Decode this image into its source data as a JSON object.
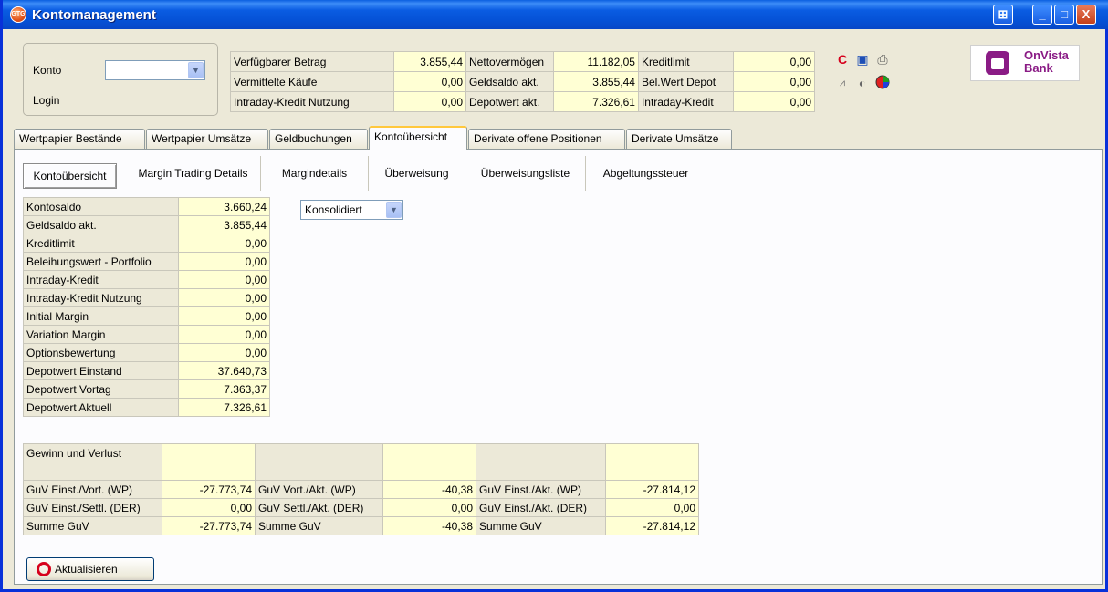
{
  "window": {
    "title": "Kontomanagement",
    "app_icon": "GTG",
    "min": "_",
    "max": "□",
    "close": "X",
    "extra": "⊞"
  },
  "login": {
    "konto_label": "Konto",
    "login_label": "Login",
    "konto_value": ""
  },
  "summary": [
    [
      "Verfügbarer Betrag",
      "3.855,44",
      "Nettovermögen",
      "11.182,05",
      "Kreditlimit",
      "0,00"
    ],
    [
      "Vermittelte Käufe",
      "0,00",
      "Geldsaldo akt.",
      "3.855,44",
      "Bel.Wert Depot",
      "0,00"
    ],
    [
      "Intraday-Kredit Nutzung",
      "0,00",
      "Depotwert akt.",
      "7.326,61",
      "Intraday-Kredit",
      "0,00"
    ]
  ],
  "logo": {
    "line1": "OnVista",
    "line2": "Bank"
  },
  "tabs": [
    "Wertpapier Bestände",
    "Wertpapier Umsätze",
    "Geldbuchungen",
    "Kontoübersicht",
    "Derivate offene Positionen",
    "Derivate Umsätze"
  ],
  "subtabs": [
    "Kontoübersicht",
    "Margin Trading Details",
    "Margindetails",
    "Überweisung",
    "Überweisungsliste",
    "Abgeltungssteuer"
  ],
  "konto": [
    [
      "Kontosaldo",
      "3.660,24"
    ],
    [
      "Geldsaldo akt.",
      "3.855,44"
    ],
    [
      "Kreditlimit",
      "0,00"
    ],
    [
      "Beleihungswert - Portfolio",
      "0,00"
    ],
    [
      "Intraday-Kredit",
      "0,00"
    ],
    [
      "Intraday-Kredit Nutzung",
      "0,00"
    ],
    [
      "Initial Margin",
      "0,00"
    ],
    [
      "Variation Margin",
      "0,00"
    ],
    [
      "Optionsbewertung",
      "0,00"
    ],
    [
      "Depotwert Einstand",
      "37.640,73"
    ],
    [
      "Depotwert Vortag",
      "7.363,37"
    ],
    [
      "Depotwert Aktuell",
      "7.326,61"
    ]
  ],
  "mode_select": "Konsolidiert",
  "guv": {
    "header": "Gewinn und Verlust",
    "rows": [
      [
        "GuV Einst./Vort. (WP)",
        "-27.773,74",
        "GuV Vort./Akt. (WP)",
        "-40,38",
        "GuV Einst./Akt. (WP)",
        "-27.814,12"
      ],
      [
        "GuV Einst./Settl. (DER)",
        "0,00",
        "GuV Settl./Akt. (DER)",
        "0,00",
        "GuV Einst./Akt. (DER)",
        "0,00"
      ],
      [
        "Summe GuV",
        "-27.773,74",
        "Summe GuV",
        "-40,38",
        "Summe GuV",
        "-27.814,12"
      ]
    ]
  },
  "update_button": "Aktualisieren"
}
